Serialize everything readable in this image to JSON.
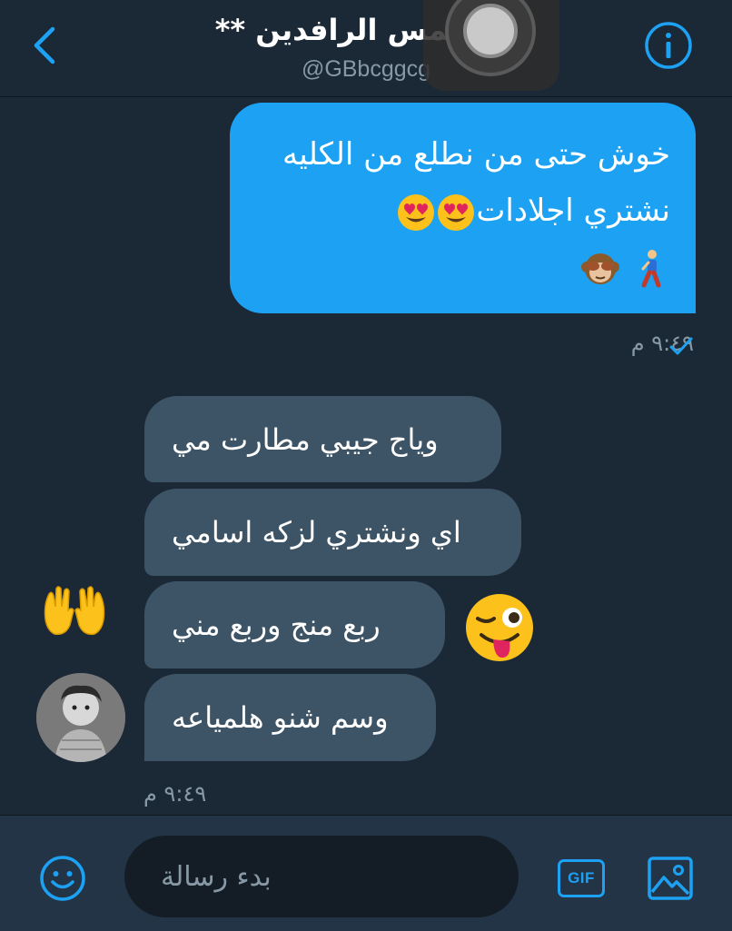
{
  "header": {
    "title": "** شمس الرافدين **",
    "handle": "@GBbcggcg"
  },
  "messages": {
    "sent": {
      "line1": "خوش حتى من نطلع من الكليه",
      "line2": "نشتري اجلادات",
      "time": "٩:٤٩ م",
      "emoji_line2": [
        "heart-eyes-emoji",
        "heart-eyes-emoji"
      ],
      "emoji_line3": [
        "walking-person-emoji",
        "see-no-evil-monkey-emoji"
      ]
    },
    "received": [
      {
        "text": "وياج جيبي مطارت مي"
      },
      {
        "text": "اي ونشتري لزكه اسامي"
      },
      {
        "text": "ربع منج وربع مني"
      },
      {
        "text": "وسم شنو هلمياعه"
      }
    ],
    "received_time": "٩:٤٩ م",
    "floating_emoji": [
      "raised-hands-emoji",
      "winking-tongue-emoji"
    ]
  },
  "composer": {
    "placeholder": "بدء رسالة",
    "gif_label": "GIF"
  },
  "colors": {
    "background": "#1b2836",
    "accent": "#1da1f2",
    "received_bubble": "#3d5466",
    "muted_text": "#8899a6"
  }
}
